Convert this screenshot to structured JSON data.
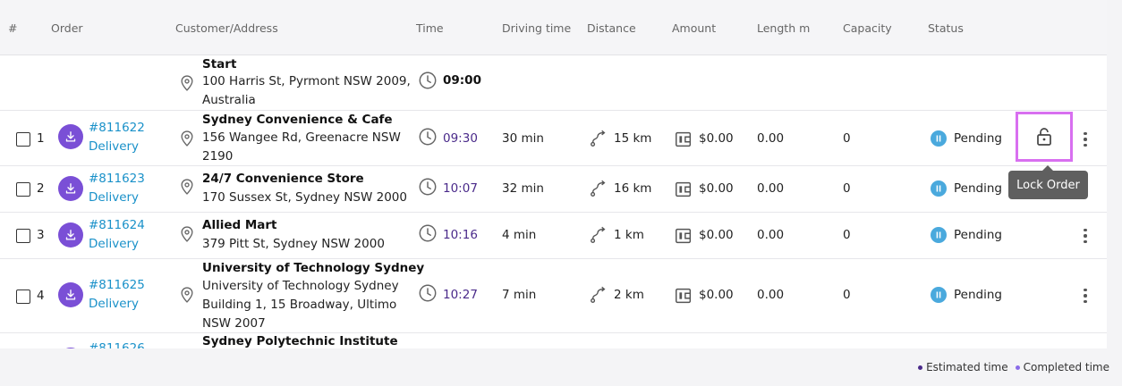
{
  "colors": {
    "order_link": "#1a91c9",
    "estimated_dot": "#4a2a8a",
    "completed_dot": "#8a6be8",
    "status_pending": "#4aa9dd",
    "order_icon": "#7a4fd6",
    "highlight": "#d86ff0"
  },
  "header": {
    "num": "#",
    "order": "Order",
    "customer": "Customer/Address",
    "time": "Time",
    "driving": "Driving time",
    "distance": "Distance",
    "amount": "Amount",
    "length": "Length m",
    "capacity": "Capacity",
    "status": "Status"
  },
  "start": {
    "name": "Start",
    "address_lines": [
      "100 Harris St, Pyrmont NSW 2009,",
      "Australia"
    ],
    "time": "09:00"
  },
  "rows": [
    {
      "index": "1",
      "order_id": "#811622",
      "type": "Delivery",
      "name": "Sydney Convenience & Cafe",
      "address_lines": [
        "156 Wangee Rd, Greenacre NSW",
        "2190"
      ],
      "time": "09:30",
      "driving": "30 min",
      "distance": "15 km",
      "amount": "$0.00",
      "length": "0.00",
      "capacity": "0",
      "status": "Pending"
    },
    {
      "index": "2",
      "order_id": "#811623",
      "type": "Delivery",
      "name": "24/7 Convenience Store",
      "address_lines": [
        "170 Sussex St, Sydney NSW 2000"
      ],
      "time": "10:07",
      "driving": "32 min",
      "distance": "16 km",
      "amount": "$0.00",
      "length": "0.00",
      "capacity": "0",
      "status": "Pending"
    },
    {
      "index": "3",
      "order_id": "#811624",
      "type": "Delivery",
      "name": "Allied Mart",
      "address_lines": [
        "379 Pitt St, Sydney NSW 2000"
      ],
      "time": "10:16",
      "driving": "4 min",
      "distance": "1 km",
      "amount": "$0.00",
      "length": "0.00",
      "capacity": "0",
      "status": "Pending"
    },
    {
      "index": "4",
      "order_id": "#811625",
      "type": "Delivery",
      "name": "University of Technology Sydney",
      "address_lines": [
        "University of Technology Sydney",
        "Building 1, 15 Broadway, Ultimo",
        "NSW 2007"
      ],
      "time": "10:27",
      "driving": "7 min",
      "distance": "2 km",
      "amount": "$0.00",
      "length": "0.00",
      "capacity": "0",
      "status": "Pending"
    },
    {
      "order_id": "#811626",
      "name": "Sydney Polytechnic Institute"
    }
  ],
  "tooltip": "Lock Order",
  "legend": {
    "estimated": "Estimated time",
    "completed": "Completed time"
  }
}
